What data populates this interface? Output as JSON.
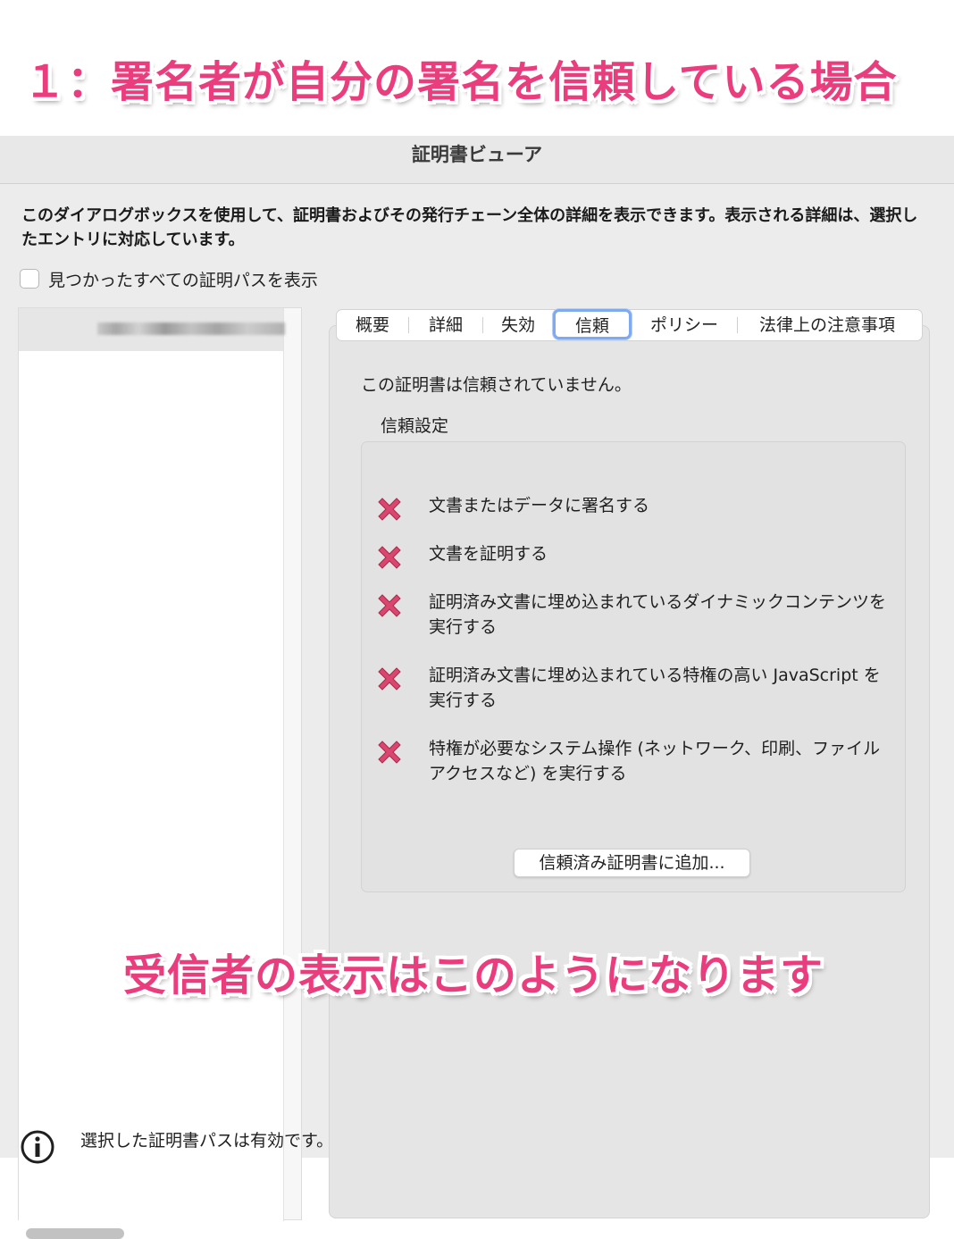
{
  "annotation": {
    "top": "１：署名者が自分の署名を信頼している場合",
    "bottom": "受信者の表示はこのようになります"
  },
  "window": {
    "title": "証明書ビューア"
  },
  "description": "このダイアログボックスを使用して、証明書およびその発行チェーン全体の詳細を表示できます。表示される詳細は、選択したエントリに対応しています。",
  "show_all_paths": {
    "label": "見つかったすべての証明パスを表示",
    "checked": false
  },
  "tabs": [
    {
      "label": "概要"
    },
    {
      "label": "詳細"
    },
    {
      "label": "失効"
    },
    {
      "label": "信頼",
      "active": true
    },
    {
      "label": "ポリシー"
    },
    {
      "label": "法律上の注意事項"
    }
  ],
  "trust": {
    "status": "この証明書は信頼されていません。",
    "settings_title": "信頼設定",
    "items": [
      {
        "label": "文書またはデータに署名する",
        "icon": "x-icon"
      },
      {
        "label": "文書を証明する",
        "icon": "x-icon"
      },
      {
        "label": "証明済み文書に埋め込まれているダイナミックコンテンツを実行する",
        "icon": "x-icon"
      },
      {
        "label": "証明済み文書に埋め込まれている特権の高い JavaScript を実行する",
        "icon": "x-icon"
      },
      {
        "label": "特権が必要なシステム操作 (ネットワーク、印刷、ファイルアクセスなど) を実行する",
        "icon": "x-icon"
      }
    ],
    "add_button": "信頼済み証明書に追加..."
  },
  "footer": {
    "info": "選択した証明書パスは有効です。"
  },
  "colors": {
    "annotation": "#ea3d7e",
    "x_mark": "#d9466e",
    "active_tab_ring": "#7fa9f0"
  }
}
